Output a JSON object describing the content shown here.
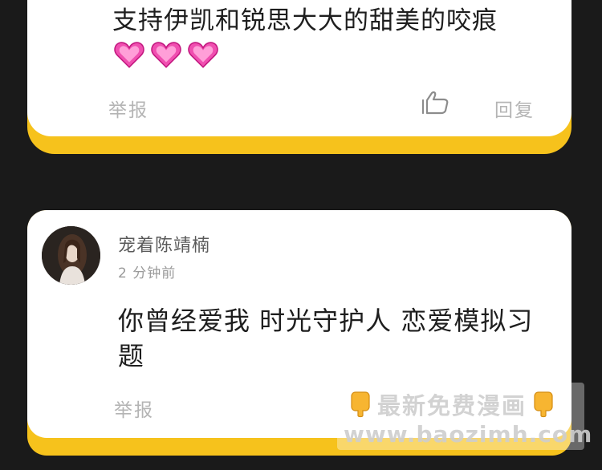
{
  "comments": [
    {
      "text": "支持伊凯和锐思大大的甜美的咬痕",
      "emoji_count": 3,
      "emoji": "pink-heart-icon",
      "report_label": "举报",
      "reply_label": "回复"
    },
    {
      "username": "宠着陈靖楠",
      "time": "2 分钟前",
      "text": "你曾经爱我 时光守护人 恋爱模拟习题",
      "report_label": "举报"
    }
  ],
  "watermark": {
    "line1": "最新免费漫画",
    "line2": "www.baozimh.com"
  },
  "colors": {
    "background": "#1a1a1a",
    "card": "#ffffff",
    "card_shadow": "#f6c21c",
    "muted_text": "#b4b4b4"
  }
}
